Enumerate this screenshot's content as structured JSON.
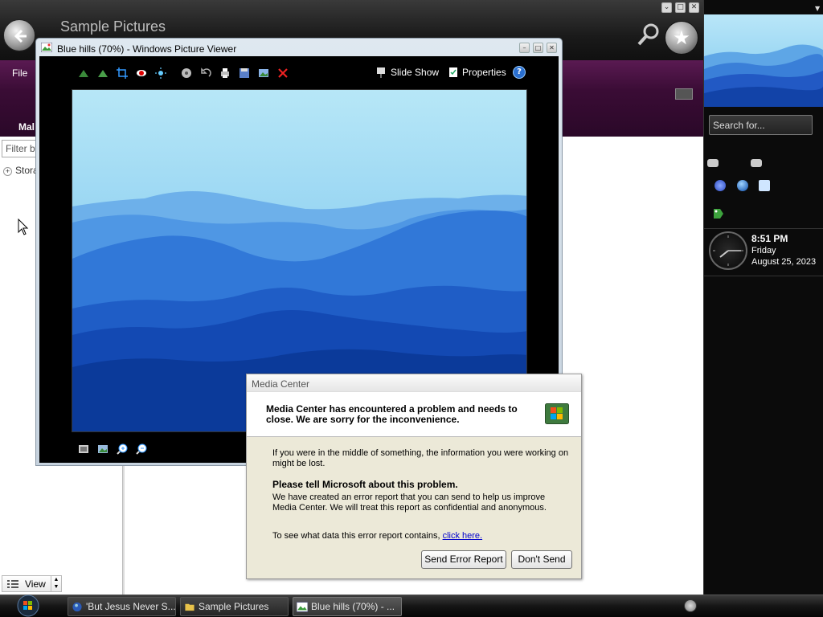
{
  "explorer": {
    "title": "Sample Pictures",
    "menu_file": "File",
    "menu_mal": "Mal",
    "filter_placeholder": "Filter by",
    "tree_item": "Stora",
    "view_label": "View"
  },
  "sidebar": {
    "search_placeholder": "Search for...",
    "clock": {
      "time": "8:51 PM",
      "day": "Friday",
      "date": "August 25, 2023"
    }
  },
  "viewer": {
    "title": "Blue hills (70%) - Windows Picture Viewer",
    "slideshow_label": "Slide Show",
    "properties_label": "Properties",
    "help_label": "?"
  },
  "dialog": {
    "title": "Media Center",
    "heading": "Media Center has encountered a problem and needs to close.  We are sorry for the inconvenience.",
    "p1": "If you were in the middle of something, the information you were working on might be lost.",
    "h2": "Please tell Microsoft about this problem.",
    "p2": "We have created an error report that you can send to help us improve Media Center.  We will treat this report as confidential and anonymous.",
    "p3": "To see what data this error report contains, ",
    "link": "click here.",
    "send_label": "Send Error Report",
    "dont_send_label": "Don't Send"
  },
  "taskbar": {
    "tasks": [
      {
        "label": "'But Jesus Never S..."
      },
      {
        "label": "Sample Pictures"
      },
      {
        "label": "Blue hills (70%) - ..."
      }
    ]
  },
  "colors": {
    "menu_band": "#3a0c35",
    "link": "#0000cc",
    "hill_light": "#9fd9f2",
    "hill_dark": "#0b3a9a"
  }
}
